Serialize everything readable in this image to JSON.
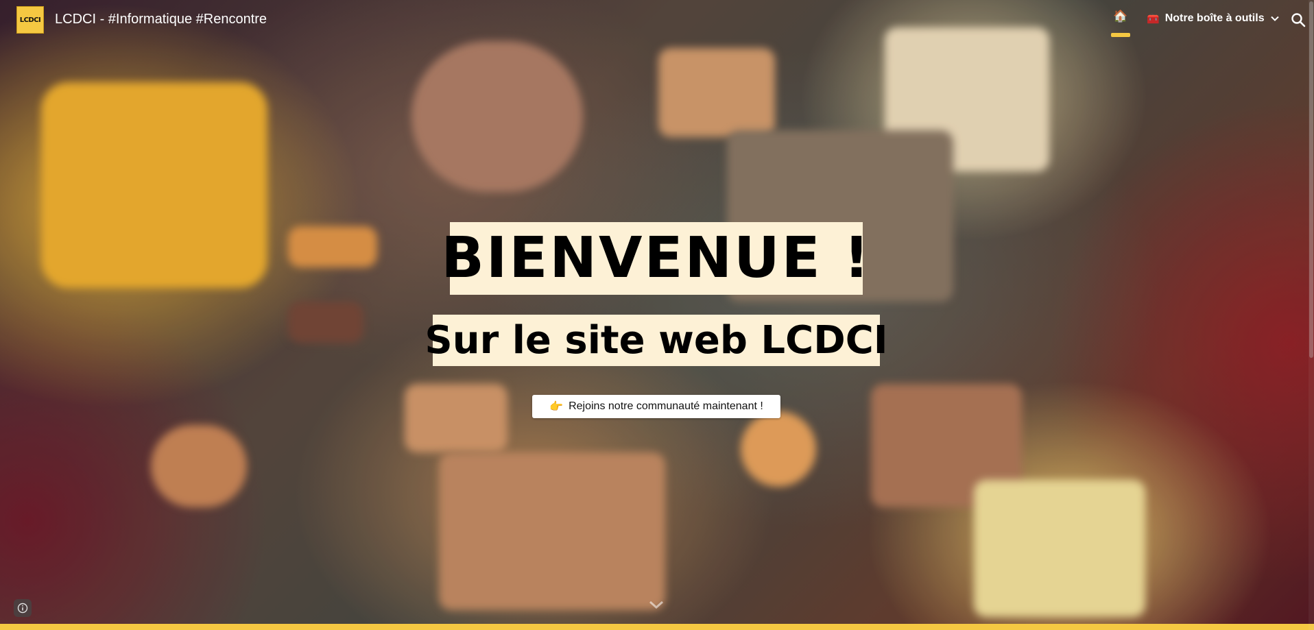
{
  "header": {
    "logo_text": "LCDCI",
    "site_title": "LCDCI - #Informatique #Rencontre",
    "nav": {
      "home_icon": "home-icon",
      "tools_icon": "toolbox-icon",
      "tools_label": "Notre boîte à outils"
    },
    "search_icon": "search-icon"
  },
  "hero": {
    "title": "BIENVENUE !",
    "subtitle": "Sur le site web LCDCI",
    "cta_icon": "pointing-right-icon",
    "cta_label": "Rejoins notre communauté maintenant !",
    "scroll_icon": "chevron-down-icon"
  },
  "footer": {
    "info_icon": "info-icon"
  },
  "colors": {
    "accent": "#f5c842",
    "highlight_bg": "#fdf1d6",
    "text_light": "#ffffff"
  }
}
